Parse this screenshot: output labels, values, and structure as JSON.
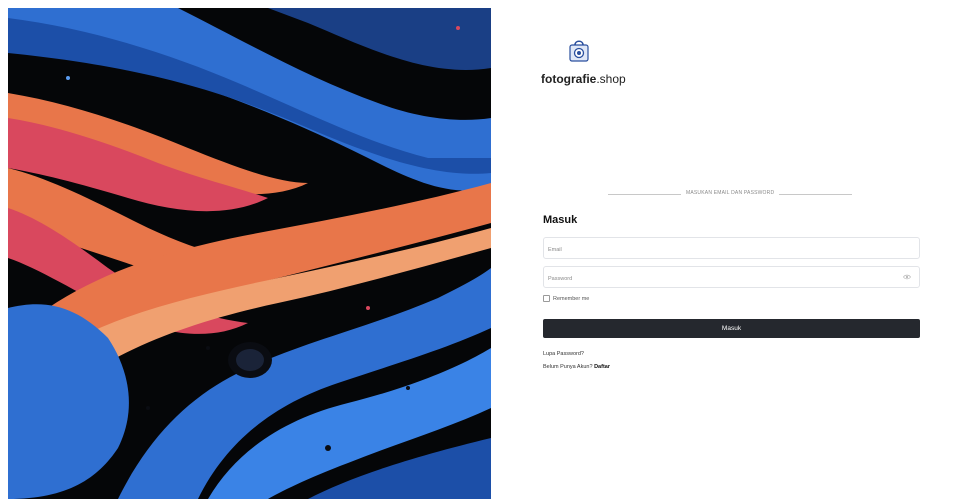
{
  "brand": {
    "name_bold": "fotografie",
    "name_rest": ".shop"
  },
  "divider_text": "MASUKAN EMAIL DAN PASSWORD",
  "form": {
    "title": "Masuk",
    "email_placeholder": "Email",
    "password_placeholder": "Password",
    "remember_label": "Remember me",
    "submit_label": "Masuk",
    "forgot_label": "Lupa Password?",
    "signup_prompt": "Belum Punya Akun?",
    "signup_link": "Daftar"
  },
  "colors": {
    "button_bg": "#25282e",
    "hero_blue": "#2f6fd1",
    "hero_orange": "#e8764a",
    "hero_pink": "#d9485e"
  },
  "icons": {
    "logo": "shopping-bag-camera-icon",
    "password_toggle": "eye-icon"
  }
}
